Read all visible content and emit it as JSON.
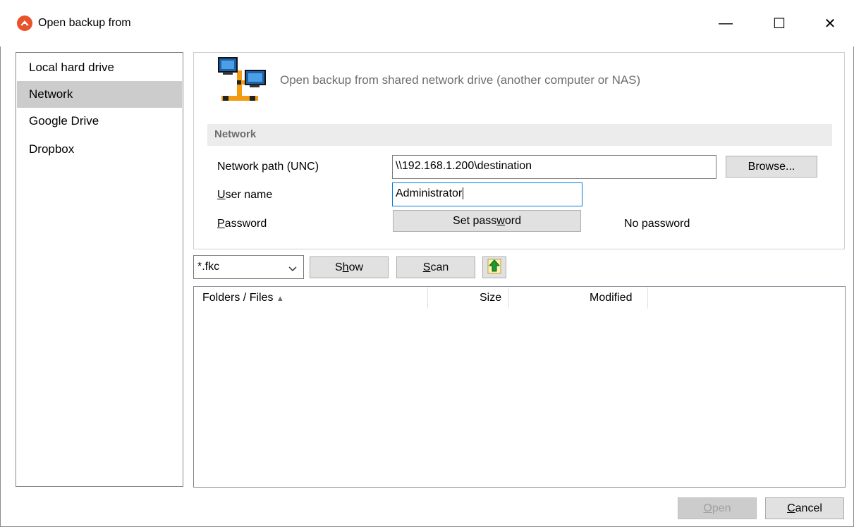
{
  "window": {
    "title": "Open backup from",
    "minimize_glyph": "—",
    "maximize_glyph": "☐",
    "close_glyph": "✕"
  },
  "sidebar": {
    "items": [
      {
        "label": "Local hard drive",
        "selected": false
      },
      {
        "label": "Network",
        "selected": true
      },
      {
        "label": "Google Drive",
        "selected": false
      },
      {
        "label": "Dropbox",
        "selected": false
      }
    ]
  },
  "header": {
    "icon": "network-computers-icon",
    "description": "Open backup from shared network drive (another computer or NAS)"
  },
  "network_section": {
    "title": "Network",
    "path_label": "Network path (UNC)",
    "path_value": "\\\\192.168.1.200\\destination",
    "browse_label": "Browse...",
    "username_label_key": "U",
    "username_label_rest": "ser name",
    "username_value": "Administrator",
    "password_label_key": "P",
    "password_label_rest": "assword",
    "set_password_pre": "Set pass",
    "set_password_key": "w",
    "set_password_post": "ord",
    "password_status": "No password"
  },
  "toolbar": {
    "filter_value": "*.fkc",
    "show_pre": "S",
    "show_key": "h",
    "show_post": "ow",
    "scan_key": "S",
    "scan_post": "can",
    "up_icon": "folder-up-icon"
  },
  "file_list": {
    "columns": [
      "Folders / Files",
      "Size",
      "Modified"
    ],
    "sort_indicator": "▲",
    "rows": []
  },
  "footer": {
    "open_key": "O",
    "open_post": "pen",
    "cancel_key": "C",
    "cancel_post": "ancel"
  },
  "colors": {
    "accent": "#0078d7",
    "selection": "#cccccc",
    "brand_icon": "#e8532b",
    "up_arrow": "#1c9a2c"
  }
}
